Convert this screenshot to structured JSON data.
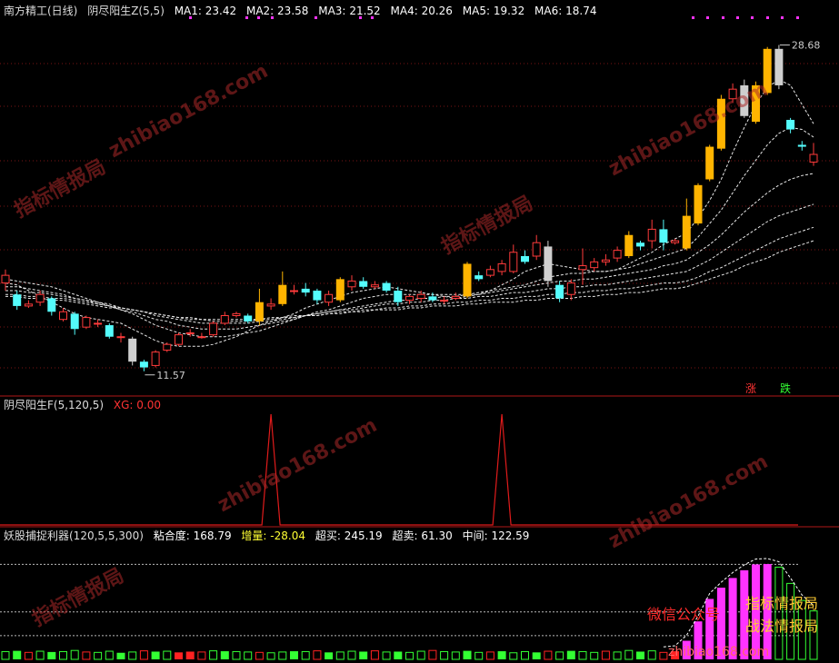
{
  "header": {
    "market": "南方精工(日线)",
    "indicator": "阴尽阳生Z(5,5)",
    "ma_items": [
      {
        "label": "MA1:",
        "value": "23.42"
      },
      {
        "label": "MA2:",
        "value": "23.58"
      },
      {
        "label": "MA3:",
        "value": "21.52"
      },
      {
        "label": "MA4:",
        "value": "20.26"
      },
      {
        "label": "MA5:",
        "value": "19.32"
      },
      {
        "label": "MA6:",
        "value": "18.74"
      }
    ]
  },
  "panel2": {
    "title": "阴尽阳生F(5,120,5)",
    "xg_label": "XG:",
    "xg_value": "0.00"
  },
  "panel3": {
    "title": "妖股捕捉利器(120,5,5,300)",
    "items": [
      {
        "label": "粘合度:",
        "value": "168.79"
      },
      {
        "label": "增量:",
        "value": "-28.04"
      },
      {
        "label": "超买:",
        "value": "245.19"
      },
      {
        "label": "超卖:",
        "value": "61.30"
      },
      {
        "label": "中间:",
        "value": "122.59"
      }
    ]
  },
  "chart_data": {
    "type": "candlestick",
    "price_range": [
      10.5,
      30.0
    ],
    "max_label": "28.68",
    "min_label": "11.57",
    "candles": [
      [
        16.2,
        16.6,
        15.8,
        16.9
      ],
      [
        15.6,
        15.0,
        14.8,
        15.8
      ],
      [
        15.0,
        15.1,
        14.9,
        15.3
      ],
      [
        15.2,
        15.6,
        15.0,
        15.8
      ],
      [
        15.4,
        14.7,
        14.5,
        15.5
      ],
      [
        14.3,
        14.7,
        14.2,
        14.9
      ],
      [
        14.6,
        13.8,
        13.5,
        14.7
      ],
      [
        13.9,
        14.4,
        13.8,
        14.5
      ],
      [
        14.1,
        14.1,
        13.9,
        14.3
      ],
      [
        14.0,
        13.4,
        13.3,
        14.1
      ],
      [
        13.4,
        13.4,
        13.1,
        13.6
      ],
      [
        13.3,
        12.1,
        11.9,
        13.4
      ],
      [
        12.1,
        11.8,
        11.6,
        12.2
      ],
      [
        11.9,
        12.6,
        11.8,
        12.7
      ],
      [
        12.7,
        13.0,
        12.6,
        13.1
      ],
      [
        13.0,
        13.5,
        12.9,
        13.6
      ],
      [
        13.6,
        13.6,
        13.4,
        13.8
      ],
      [
        13.4,
        13.4,
        13.3,
        13.6
      ],
      [
        13.5,
        14.1,
        13.4,
        14.2
      ],
      [
        14.1,
        14.5,
        14.0,
        14.7
      ],
      [
        14.5,
        14.6,
        14.4,
        14.7
      ],
      [
        14.5,
        14.2,
        14.1,
        14.6
      ],
      [
        14.2,
        15.2,
        14.0,
        15.9
      ],
      [
        15.0,
        15.1,
        14.8,
        15.4
      ],
      [
        15.1,
        16.1,
        15.0,
        16.8
      ],
      [
        15.8,
        15.8,
        15.6,
        16.1
      ],
      [
        15.9,
        15.7,
        15.5,
        16.2
      ],
      [
        15.8,
        15.3,
        15.1,
        15.9
      ],
      [
        15.2,
        15.6,
        15.0,
        15.8
      ],
      [
        15.3,
        16.4,
        15.2,
        16.5
      ],
      [
        16.0,
        16.3,
        15.8,
        16.6
      ],
      [
        16.3,
        16.0,
        15.9,
        16.5
      ],
      [
        16.0,
        16.1,
        15.9,
        16.3
      ],
      [
        16.2,
        15.8,
        15.7,
        16.3
      ],
      [
        15.8,
        15.2,
        15.0,
        16.0
      ],
      [
        15.3,
        15.5,
        15.1,
        15.6
      ],
      [
        15.4,
        15.6,
        15.2,
        15.8
      ],
      [
        15.5,
        15.3,
        15.2,
        15.7
      ],
      [
        15.3,
        15.3,
        15.1,
        15.5
      ],
      [
        15.4,
        15.5,
        15.3,
        15.7
      ],
      [
        15.5,
        17.2,
        15.4,
        17.3
      ],
      [
        16.6,
        16.4,
        16.3,
        16.8
      ],
      [
        16.6,
        16.9,
        16.5,
        17.1
      ],
      [
        16.8,
        17.2,
        16.6,
        17.4
      ],
      [
        16.8,
        17.8,
        16.7,
        18.2
      ],
      [
        17.6,
        17.3,
        17.2,
        17.9
      ],
      [
        17.6,
        18.3,
        17.4,
        18.7
      ],
      [
        18.1,
        16.3,
        16.0,
        18.4
      ],
      [
        16.1,
        15.4,
        15.2,
        16.3
      ],
      [
        15.6,
        16.2,
        15.3,
        16.4
      ],
      [
        16.9,
        17.1,
        16.1,
        18.0
      ],
      [
        17.0,
        17.3,
        16.8,
        17.5
      ],
      [
        17.3,
        17.4,
        17.1,
        17.7
      ],
      [
        17.5,
        17.9,
        17.3,
        18.1
      ],
      [
        17.6,
        18.7,
        17.5,
        18.9
      ],
      [
        18.3,
        18.1,
        17.9,
        18.4
      ],
      [
        18.4,
        19.0,
        18.0,
        19.5
      ],
      [
        19.0,
        18.3,
        17.9,
        19.5
      ],
      [
        18.3,
        18.4,
        18.2,
        18.5
      ],
      [
        18.0,
        19.7,
        17.9,
        20.6
      ],
      [
        19.3,
        21.3,
        19.2,
        21.4
      ],
      [
        21.6,
        23.3,
        21.5,
        23.4
      ],
      [
        23.2,
        25.8,
        23.1,
        26.0
      ],
      [
        25.8,
        26.3,
        25.6,
        26.6
      ],
      [
        26.5,
        24.9,
        24.8,
        26.8
      ],
      [
        24.6,
        26.5,
        24.5,
        26.7
      ],
      [
        26.1,
        28.4,
        26.0,
        28.5
      ],
      [
        28.4,
        26.5,
        26.3,
        28.6
      ],
      [
        24.7,
        24.2,
        24.0,
        24.8
      ],
      [
        23.4,
        23.3,
        23.1,
        23.6
      ],
      [
        22.5,
        22.9,
        22.3,
        23.5
      ]
    ],
    "ma_lines": [
      [
        16.2,
        16.1,
        15.8,
        15.5,
        15.2,
        14.9,
        14.6,
        14.4,
        14.3,
        14.2,
        14.1,
        13.8,
        13.5,
        13.2,
        13.0,
        12.9,
        12.9,
        12.9,
        13.0,
        13.2,
        13.4,
        13.7,
        14.0,
        14.2,
        14.4,
        14.6,
        14.9,
        15.1,
        15.3,
        15.5,
        15.7,
        15.8,
        15.9,
        16.0,
        15.9,
        15.8,
        15.7,
        15.6,
        15.5,
        15.4,
        15.5,
        15.6,
        15.8,
        16.1,
        16.4,
        16.8,
        17.0,
        17.2,
        17.1,
        17.0,
        16.9,
        16.8,
        16.8,
        16.9,
        17.2,
        17.5,
        17.8,
        18.2,
        18.5,
        18.8,
        19.6,
        20.5,
        21.6,
        23.0,
        24.3,
        25.5,
        26.4,
        26.8,
        26.5,
        25.5,
        24.5
      ],
      [
        16.4,
        16.3,
        16.2,
        16.1,
        16.0,
        15.8,
        15.6,
        15.4,
        15.2,
        15.0,
        14.8,
        14.6,
        14.3,
        14.0,
        13.8,
        13.6,
        13.5,
        13.4,
        13.4,
        13.4,
        13.5,
        13.6,
        13.7,
        13.9,
        14.1,
        14.3,
        14.5,
        14.7,
        14.8,
        15.0,
        15.2,
        15.4,
        15.5,
        15.6,
        15.6,
        15.6,
        15.6,
        15.6,
        15.6,
        15.6,
        15.6,
        15.7,
        15.8,
        15.9,
        16.0,
        16.1,
        16.3,
        16.5,
        16.6,
        16.7,
        16.7,
        16.8,
        16.8,
        16.9,
        17.0,
        17.2,
        17.4,
        17.6,
        17.8,
        18.0,
        18.6,
        19.3,
        20.0,
        20.9,
        21.8,
        22.6,
        23.4,
        24.0,
        24.3,
        24.2,
        23.8
      ],
      [
        16.0,
        16.0,
        15.9,
        15.8,
        15.7,
        15.6,
        15.4,
        15.3,
        15.1,
        15.0,
        14.8,
        14.7,
        14.5,
        14.3,
        14.2,
        14.0,
        13.9,
        13.8,
        13.8,
        13.8,
        13.8,
        13.9,
        14.0,
        14.1,
        14.2,
        14.3,
        14.5,
        14.6,
        14.7,
        14.8,
        14.9,
        15.0,
        15.1,
        15.2,
        15.3,
        15.3,
        15.4,
        15.4,
        15.5,
        15.5,
        15.6,
        15.6,
        15.7,
        15.8,
        15.9,
        16.0,
        16.1,
        16.2,
        16.3,
        16.3,
        16.4,
        16.4,
        16.5,
        16.6,
        16.7,
        16.8,
        16.9,
        17.1,
        17.2,
        17.4,
        17.8,
        18.2,
        18.7,
        19.3,
        19.9,
        20.4,
        20.9,
        21.3,
        21.6,
        21.8,
        21.9
      ],
      [
        15.8,
        15.8,
        15.7,
        15.7,
        15.6,
        15.5,
        15.4,
        15.3,
        15.2,
        15.1,
        14.9,
        14.8,
        14.7,
        14.5,
        14.4,
        14.3,
        14.2,
        14.1,
        14.1,
        14.1,
        14.1,
        14.1,
        14.2,
        14.2,
        14.3,
        14.4,
        14.5,
        14.6,
        14.7,
        14.8,
        14.8,
        14.9,
        15.0,
        15.1,
        15.1,
        15.2,
        15.2,
        15.3,
        15.3,
        15.4,
        15.4,
        15.5,
        15.5,
        15.6,
        15.7,
        15.7,
        15.8,
        15.9,
        15.9,
        16.0,
        16.0,
        16.1,
        16.1,
        16.2,
        16.3,
        16.4,
        16.5,
        16.6,
        16.7,
        16.8,
        17.1,
        17.4,
        17.8,
        18.2,
        18.6,
        19.0,
        19.4,
        19.7,
        19.9,
        20.1,
        20.3
      ],
      [
        15.6,
        15.6,
        15.5,
        15.5,
        15.4,
        15.4,
        15.3,
        15.2,
        15.1,
        15.0,
        14.9,
        14.8,
        14.7,
        14.6,
        14.5,
        14.4,
        14.3,
        14.3,
        14.2,
        14.2,
        14.2,
        14.2,
        14.3,
        14.3,
        14.4,
        14.4,
        14.5,
        14.5,
        14.6,
        14.7,
        14.7,
        14.8,
        14.8,
        14.9,
        14.9,
        15.0,
        15.0,
        15.1,
        15.1,
        15.2,
        15.2,
        15.3,
        15.3,
        15.4,
        15.4,
        15.5,
        15.5,
        15.6,
        15.6,
        15.7,
        15.7,
        15.8,
        15.8,
        15.9,
        15.9,
        16.0,
        16.1,
        16.2,
        16.2,
        16.3,
        16.5,
        16.8,
        17.0,
        17.3,
        17.6,
        17.9,
        18.2,
        18.5,
        18.7,
        18.9,
        19.1
      ],
      [
        15.5,
        15.5,
        15.4,
        15.4,
        15.3,
        15.3,
        15.2,
        15.1,
        15.0,
        14.9,
        14.9,
        14.8,
        14.7,
        14.6,
        14.5,
        14.4,
        14.4,
        14.3,
        14.3,
        14.3,
        14.3,
        14.3,
        14.3,
        14.4,
        14.4,
        14.5,
        14.5,
        14.5,
        14.6,
        14.6,
        14.7,
        14.7,
        14.8,
        14.8,
        14.8,
        14.9,
        14.9,
        15.0,
        15.0,
        15.0,
        15.1,
        15.1,
        15.2,
        15.2,
        15.2,
        15.3,
        15.3,
        15.4,
        15.4,
        15.4,
        15.5,
        15.5,
        15.6,
        15.6,
        15.7,
        15.7,
        15.8,
        15.9,
        15.9,
        16.0,
        16.2,
        16.4,
        16.6,
        16.8,
        17.1,
        17.3,
        17.5,
        17.8,
        18.0,
        18.2,
        18.4
      ]
    ],
    "signal_labels": [
      "涨",
      "跌"
    ],
    "xg_peaks": [
      23,
      43
    ],
    "osc_range": [
      0,
      300
    ],
    "osc_reference_lines": [
      245.19,
      122.59,
      61.3
    ],
    "osc_values": [
      20,
      22,
      18,
      21,
      19,
      20,
      23,
      19,
      18,
      21,
      17,
      19,
      22,
      20,
      21,
      18,
      20,
      19,
      22,
      21,
      20,
      19,
      18,
      17,
      19,
      21,
      20,
      22,
      18,
      19,
      21,
      20,
      22,
      19,
      20,
      18,
      21,
      23,
      20,
      19,
      22,
      18,
      19,
      21,
      17,
      20,
      18,
      21,
      19,
      22,
      20,
      18,
      21,
      19,
      23,
      20,
      22,
      18,
      21,
      48,
      98,
      156,
      185,
      210,
      230,
      245,
      246,
      238,
      196,
      152,
      125
    ],
    "overlay_texts": [
      "微信公众号",
      "指标情报局",
      "战法情报局",
      "zhibiao168.com"
    ]
  }
}
